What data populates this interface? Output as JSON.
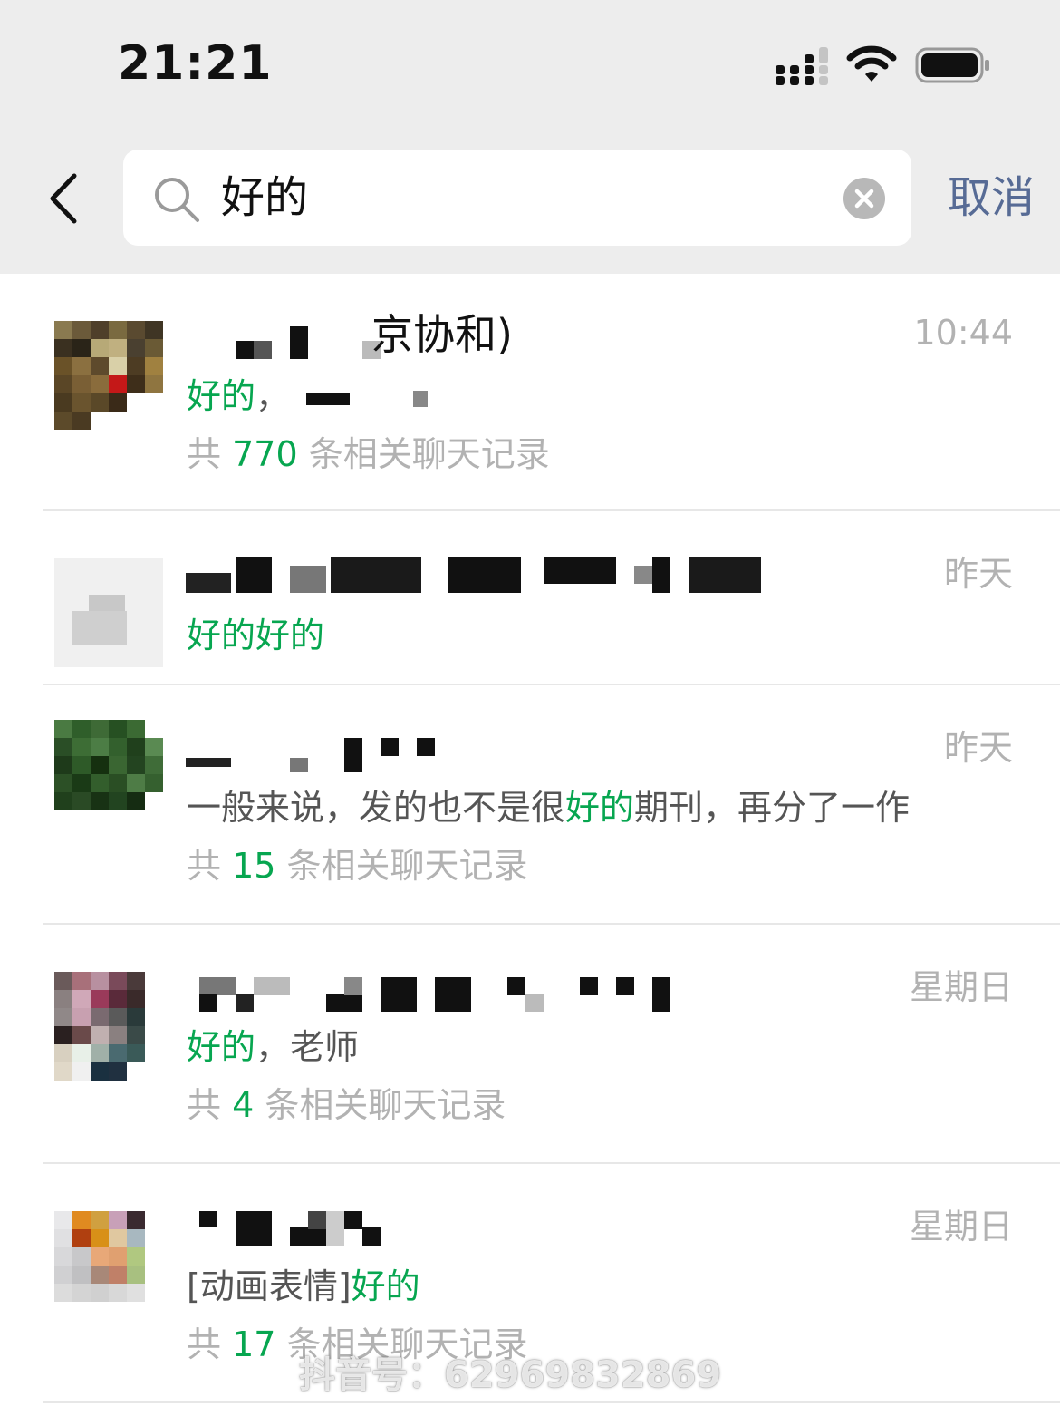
{
  "status_bar": {
    "time": "21:21"
  },
  "search": {
    "value": "好的",
    "cancel_label": "取消"
  },
  "results": [
    {
      "name_visible": "京协和)",
      "time": "10:44",
      "snippet": [
        {
          "text": "好的",
          "hl": true
        },
        {
          "text": "，",
          "hl": false
        }
      ],
      "count_prefix": "共 ",
      "count": "770",
      "count_suffix": " 条相关聊天记录"
    },
    {
      "time": "昨天",
      "snippet": [
        {
          "text": "好的好的",
          "hl": true
        }
      ]
    },
    {
      "time": "昨天",
      "snippet": [
        {
          "text": "一般来说，发的也不是很",
          "hl": false
        },
        {
          "text": "好的",
          "hl": true
        },
        {
          "text": "期刊，再分了一作",
          "hl": false
        }
      ],
      "count_prefix": "共 ",
      "count": "15",
      "count_suffix": " 条相关聊天记录"
    },
    {
      "time": "星期日",
      "snippet": [
        {
          "text": "好的",
          "hl": true
        },
        {
          "text": "，老师",
          "hl": false
        }
      ],
      "count_prefix": "共 ",
      "count": "4",
      "count_suffix": " 条相关聊天记录"
    },
    {
      "time": "星期日",
      "snippet": [
        {
          "text": "[动画表情]",
          "hl": false
        },
        {
          "text": "好的",
          "hl": true
        }
      ],
      "count_prefix": "共 ",
      "count": "17",
      "count_suffix": " 条相关聊天记录"
    }
  ],
  "watermark": "抖音号：62969832869",
  "colors": {
    "highlight": "#07a650",
    "cancel": "#576b95",
    "muted": "#b2b2b2",
    "header_bg": "#ededed"
  },
  "icons": [
    "signal-icon",
    "wifi-icon",
    "battery-icon",
    "back-chevron-icon",
    "search-icon",
    "clear-icon"
  ]
}
